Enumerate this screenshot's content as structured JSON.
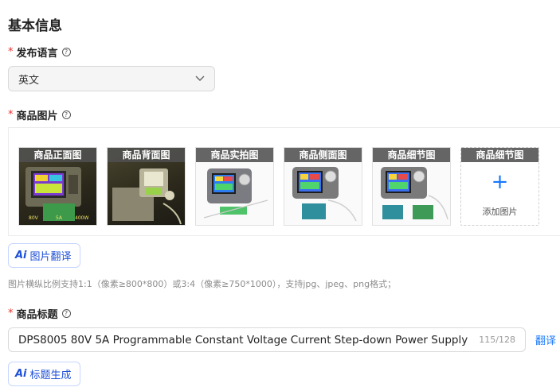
{
  "section": {
    "title": "基本信息"
  },
  "publish_language": {
    "required_mark": "*",
    "label": "发布语言",
    "help_icon": "question-circle-icon",
    "selected": "英文",
    "dropdown_icon": "chevron-down-icon"
  },
  "product_images": {
    "required_mark": "*",
    "label": "商品图片",
    "help_icon": "question-circle-icon",
    "images": [
      {
        "caption": "商品正面图"
      },
      {
        "caption": "商品背面图"
      },
      {
        "caption": "商品实拍图"
      },
      {
        "caption": "商品侧面图"
      },
      {
        "caption": "商品细节图"
      }
    ],
    "add_slot": {
      "caption": "商品细节图",
      "plus": "+",
      "label": "添加图片"
    },
    "translate_button": {
      "logo": "Ai",
      "label": "图片翻译"
    },
    "hint": "图片横纵比例支持1:1（像素≥800*800）或3:4（像素≥750*1000），支持jpg、jpeg、png格式；"
  },
  "product_title": {
    "required_mark": "*",
    "label": "商品标题",
    "help_icon": "question-circle-icon",
    "value": "DPS8005 80V 5A Programmable Constant Voltage Current Step-down Power Supply",
    "counter": "115/128",
    "translate_link": "翻译",
    "generate_button": {
      "logo": "Ai",
      "label": "标题生成"
    }
  },
  "colors": {
    "accent": "#1677ff",
    "required": "#e5322d",
    "ai_button_text": "#1d4fd8"
  }
}
